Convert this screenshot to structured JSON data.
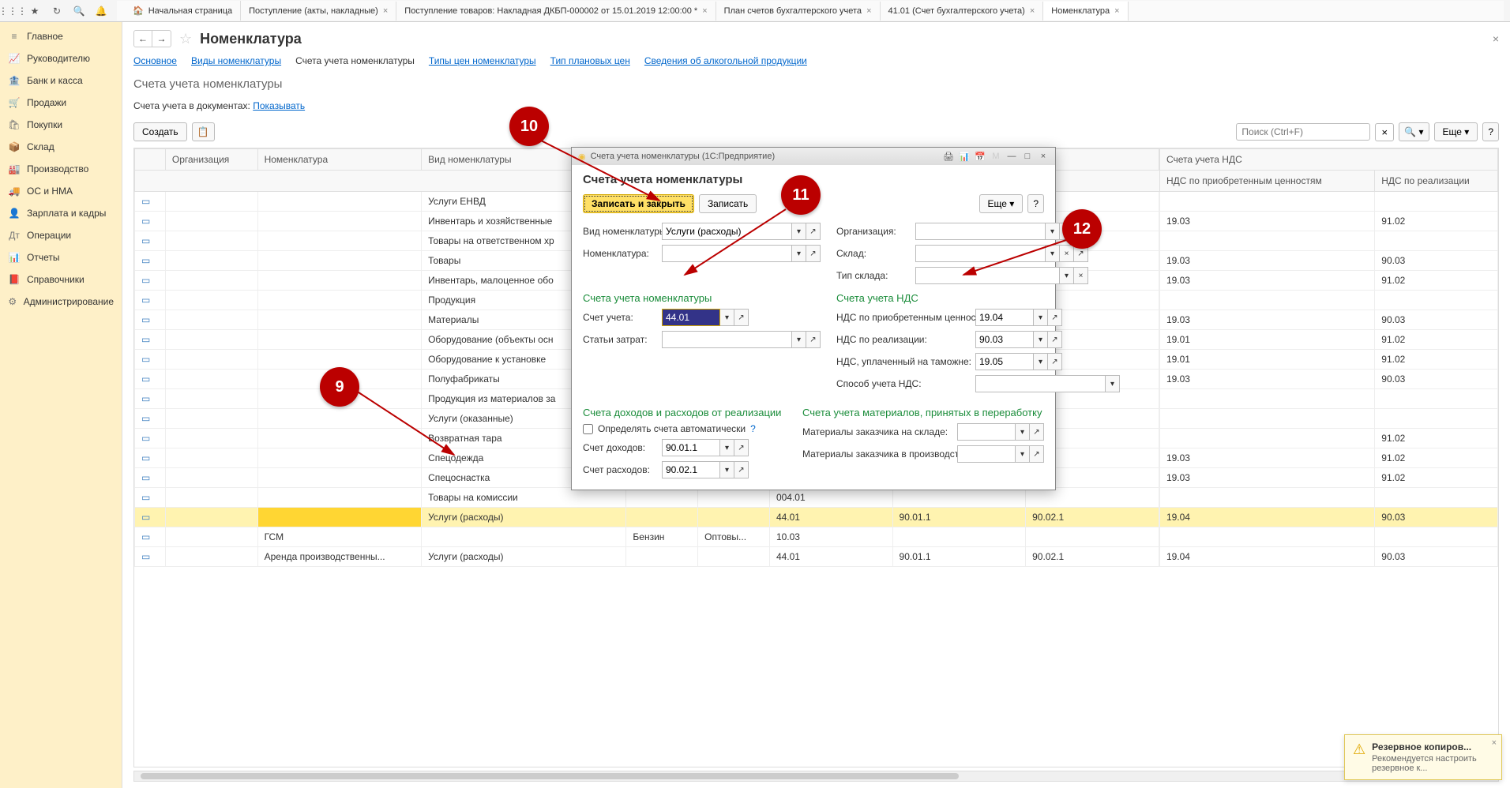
{
  "toolbar_icons": [
    "apps",
    "star",
    "history",
    "search",
    "bell"
  ],
  "tabs": [
    {
      "label": "Начальная страница",
      "home": true
    },
    {
      "label": "Поступление (акты, накладные)"
    },
    {
      "label": "Поступление товаров: Накладная ДКБП-000002 от 15.01.2019 12:00:00 *"
    },
    {
      "label": "План счетов бухгалтерского учета"
    },
    {
      "label": "41.01 (Счет бухгалтерского учета)"
    },
    {
      "label": "Номенклатура",
      "active": true
    }
  ],
  "sidebar": [
    {
      "icon": "≡",
      "label": "Главное"
    },
    {
      "icon": "📈",
      "label": "Руководителю"
    },
    {
      "icon": "🏦",
      "label": "Банк и касса"
    },
    {
      "icon": "🛒",
      "label": "Продажи"
    },
    {
      "icon": "🛍",
      "label": "Покупки"
    },
    {
      "icon": "📦",
      "label": "Склад"
    },
    {
      "icon": "🏭",
      "label": "Производство"
    },
    {
      "icon": "🚚",
      "label": "ОС и НМА"
    },
    {
      "icon": "👤",
      "label": "Зарплата и кадры"
    },
    {
      "icon": "Дт",
      "label": "Операции"
    },
    {
      "icon": "📊",
      "label": "Отчеты"
    },
    {
      "icon": "📕",
      "label": "Справочники"
    },
    {
      "icon": "⚙",
      "label": "Администрирование"
    }
  ],
  "page": {
    "title": "Номенклатура",
    "subnav": [
      "Основное",
      "Виды номенклатуры",
      "Счета учета номенклатуры",
      "Типы цен номенклатуры",
      "Тип плановых цен",
      "Сведения об алкогольной продукции"
    ],
    "subnav_active": 2,
    "section_title": "Счета учета номенклатуры",
    "filter_label": "Счета учета в документах:",
    "filter_link": "Показывать",
    "create_btn": "Создать",
    "search_placeholder": "Поиск (Ctrl+F)",
    "more_btn": "Еще",
    "help_btn": "?"
  },
  "table": {
    "group_header": "Счета учета НДС",
    "cols": [
      "",
      "Организация",
      "Номенклатура",
      "Вид номенклатуры",
      "",
      "",
      "",
      "",
      "",
      "",
      "НДС по приобретенным ценностям",
      "НДС по реализации"
    ],
    "rows": [
      {
        "vid": "Услуги ЕНВД"
      },
      {
        "vid": "Инвентарь и хозяйственные",
        "nds1": "19.03",
        "nds2": "91.02"
      },
      {
        "vid": "Товары на ответственном хр"
      },
      {
        "vid": "Товары",
        "nds1": "19.03",
        "nds2": "90.03"
      },
      {
        "vid": "Инвентарь, малоценное обо",
        "nds1": "19.03",
        "nds2": "91.02"
      },
      {
        "vid": "Продукция"
      },
      {
        "vid": "Материалы",
        "nds1": "19.03",
        "nds2": "90.03"
      },
      {
        "vid": "Оборудование (объекты осн",
        "nds1": "19.01",
        "nds2": "91.02"
      },
      {
        "vid": "Оборудование к установке",
        "nds1": "19.01",
        "nds2": "91.02"
      },
      {
        "vid": "Полуфабрикаты",
        "nds1": "19.03",
        "nds2": "90.03"
      },
      {
        "vid": "Продукция из материалов за"
      },
      {
        "vid": "Услуги (оказанные)"
      },
      {
        "vid": "Возвратная тара",
        "nds1": "",
        "nds2": "91.02"
      },
      {
        "vid": "Спецодежда",
        "nds1": "19.03",
        "nds2": "91.02"
      },
      {
        "vid": "Спецоснастка",
        "nds1": "19.03",
        "nds2": "91.02"
      },
      {
        "vid": "Товары на комиссии",
        "c4": "004.01"
      },
      {
        "vid": "Услуги (расходы)",
        "selected": true,
        "c4": "44.01",
        "c5": "90.01.1",
        "c6": "90.02.1",
        "nds1": "19.04",
        "nds2": "90.03"
      },
      {
        "nom": "ГСМ",
        "vid": "",
        "c3": "Бензин",
        "c3b": "Оптовы...",
        "c4": "10.03"
      },
      {
        "nom": "Аренда производственны...",
        "vid": "Услуги (расходы)",
        "c4": "44.01",
        "c5": "90.01.1",
        "c6": "90.02.1",
        "nds1": "19.04",
        "nds2": "90.03"
      }
    ]
  },
  "modal": {
    "titlebar": "Счета учета номенклатуры  (1С:Предприятие)",
    "h1": "Счета учета номенклатуры",
    "btn_save_close": "Записать и закрыть",
    "btn_save": "Записать",
    "btn_more": "Еще",
    "btn_help": "?",
    "lbl_vid": "Вид номенклатуры:",
    "val_vid": "Услуги (расходы)",
    "lbl_org": "Организация:",
    "lbl_nom": "Номенклатура:",
    "lbl_sklad": "Склад:",
    "lbl_tip_sklada": "Тип склада:",
    "section1": "Счета учета номенклатуры",
    "lbl_schet": "Счет учета:",
    "val_schet": "44.01",
    "lbl_stati": "Статьи затрат:",
    "section2": "Счета учета НДС",
    "lbl_nds_pr": "НДС по приобретенным ценностям:",
    "val_nds_pr": "19.04",
    "lbl_nds_real": "НДС по реализации:",
    "val_nds_real": "90.03",
    "lbl_nds_tam": "НДС, уплаченный на таможне:",
    "val_nds_tam": "19.05",
    "lbl_sposob": "Способ учета НДС:",
    "section3": "Счета доходов и расходов от реализации",
    "chk_auto": "Определять счета автоматически",
    "lbl_dohod": "Счет доходов:",
    "val_dohod": "90.01.1",
    "lbl_rashod": "Счет расходов:",
    "val_rashod": "90.02.1",
    "section4": "Счета учета материалов, принятых в переработку",
    "lbl_mat_skl": "Материалы заказчика на складе:",
    "lbl_mat_pr": "Материалы заказчика в производстве:"
  },
  "annotations": {
    "a9": "9",
    "a10": "10",
    "a11": "11",
    "a12": "12"
  },
  "toast": {
    "title": "Резервное копиров...",
    "body": "Рекомендуется настроить резервное к..."
  }
}
